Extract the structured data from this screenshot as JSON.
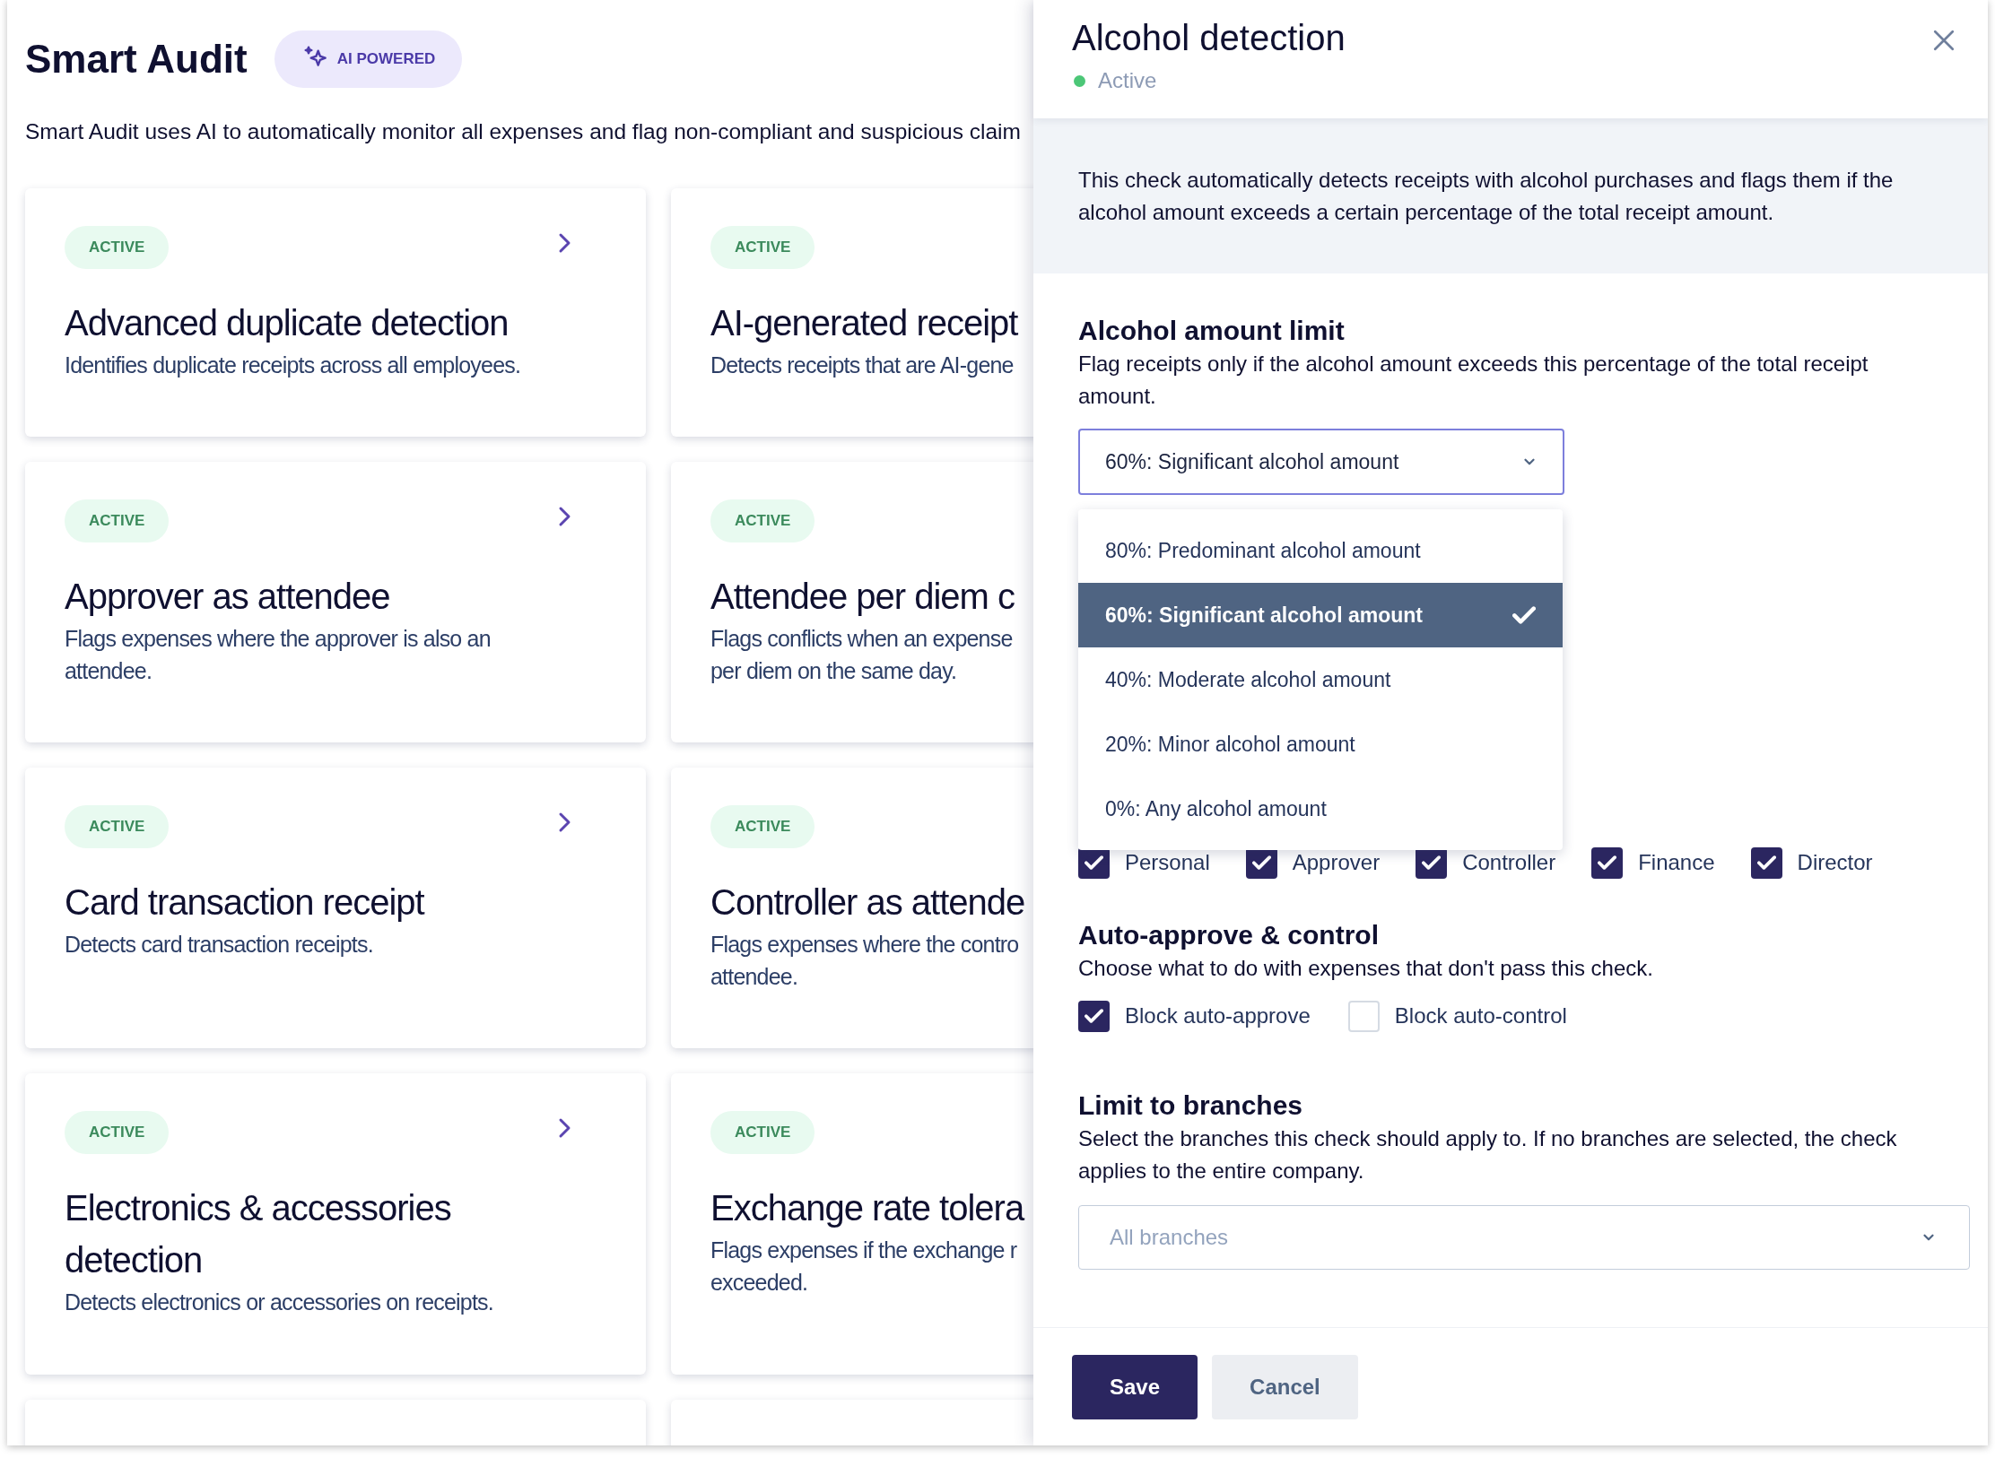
{
  "page": {
    "title": "Smart Audit",
    "badge": "AI POWERED",
    "intro": "Smart Audit uses AI to automatically monitor all expenses and flag non-compliant and suspicious claim"
  },
  "cards": [
    {
      "kind": "rule",
      "status": "ACTIVE",
      "title": "Advanced duplicate detection",
      "description": "Identifies duplicate receipts across all employees.",
      "chevron": true
    },
    {
      "kind": "rule",
      "status": "ACTIVE",
      "title": "AI-generated receipt",
      "description": "Detects receipts that are AI-gene",
      "chevron": false
    },
    {
      "kind": "rule",
      "status": "ACTIVE",
      "title": "Approver as attendee",
      "description": "Flags expenses where the approver is also an\nattendee.",
      "chevron": true
    },
    {
      "kind": "rule",
      "status": "ACTIVE",
      "title": "Attendee per diem c",
      "description": "Flags conflicts when an expense\nper diem on the same day.",
      "chevron": false
    },
    {
      "kind": "rule",
      "status": "ACTIVE",
      "title": "Card transaction receipt",
      "description": "Detects card transaction receipts.",
      "chevron": true
    },
    {
      "kind": "rule",
      "status": "ACTIVE",
      "title": "Controller as attende",
      "description": "Flags expenses where the contro\nattendee.",
      "chevron": false
    },
    {
      "kind": "rule",
      "status": "ACTIVE",
      "title": "Electronics & accessories\ndetection",
      "description": "Detects electronics or accessories on receipts.",
      "chevron": true
    },
    {
      "kind": "rule",
      "status": "ACTIVE",
      "title": "Exchange rate tolera",
      "description": "Flags expenses if the exchange r\nexceeded.",
      "chevron": false
    },
    {
      "kind": "cut"
    },
    {
      "kind": "cut"
    }
  ],
  "drawer": {
    "title": "Alcohol detection",
    "status": "Active",
    "info": "This check automatically detects receipts with alcohol purchases and flags them if the alcohol amount exceeds a certain percentage of the total receipt amount.",
    "limit": {
      "heading": "Alcohol amount limit",
      "description": "Flag receipts only if the alcohol amount exceeds this percentage of the total receipt amount.",
      "value": "60%: Significant alcohol amount",
      "options": [
        {
          "label": "80%: Predominant alcohol amount",
          "selected": false
        },
        {
          "label": "60%: Significant alcohol amount",
          "selected": true
        },
        {
          "label": "40%: Moderate alcohol amount",
          "selected": false
        },
        {
          "label": "20%: Minor alcohol amount",
          "selected": false
        },
        {
          "label": "0%: Any alcohol amount",
          "selected": false
        }
      ]
    },
    "roles": [
      {
        "label": "Personal",
        "checked": true
      },
      {
        "label": "Approver",
        "checked": true
      },
      {
        "label": "Controller",
        "checked": true
      },
      {
        "label": "Finance",
        "checked": true
      },
      {
        "label": "Director",
        "checked": true
      }
    ],
    "auto": {
      "heading": "Auto-approve & control",
      "description": "Choose what to do with expenses that don't pass this check.",
      "options": [
        {
          "label": "Block auto-approve",
          "checked": true
        },
        {
          "label": "Block auto-control",
          "checked": false
        }
      ]
    },
    "branches": {
      "heading": "Limit to branches",
      "description": "Select the branches this check should apply to. If no branches are selected, the check applies to the entire company.",
      "placeholder": "All branches"
    },
    "buttons": [
      {
        "kind": "primary",
        "label": "Save"
      },
      {
        "kind": "secondary",
        "label": "Cancel"
      }
    ]
  }
}
